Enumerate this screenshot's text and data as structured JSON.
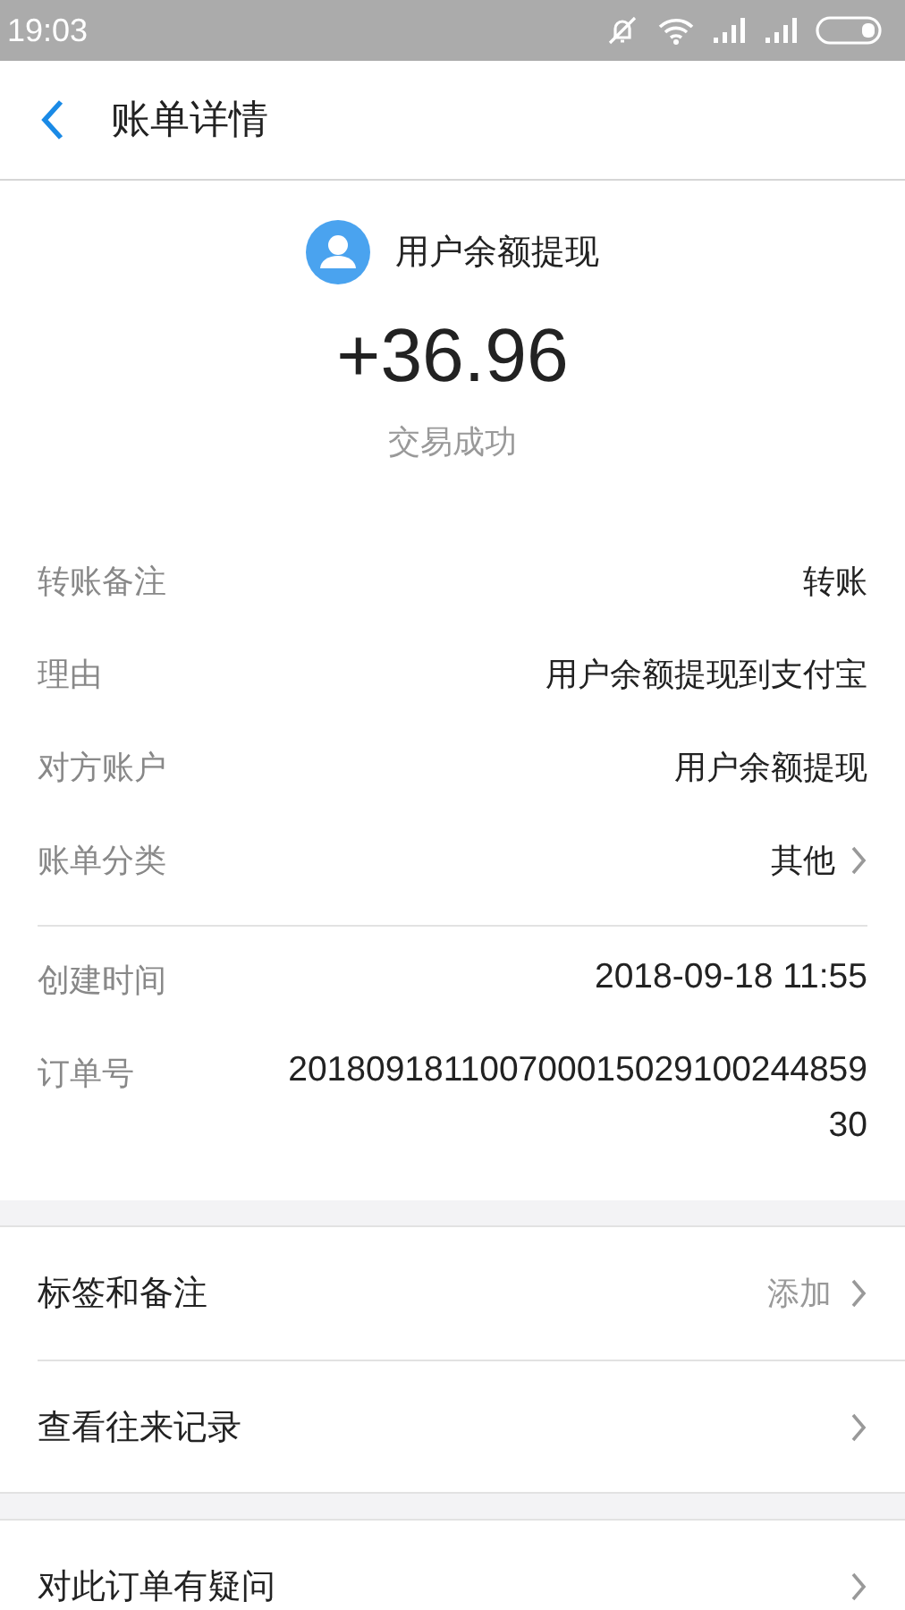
{
  "status_bar": {
    "time": "19:03"
  },
  "header": {
    "title": "账单详情"
  },
  "summary": {
    "name": "用户余额提现",
    "amount": "+36.96",
    "status": "交易成功"
  },
  "details": [
    {
      "label": "转账备注",
      "value": "转账",
      "has_arrow": false
    },
    {
      "label": "理由",
      "value": "用户余额提现到支付宝",
      "has_arrow": false
    },
    {
      "label": "对方账户",
      "value": "用户余额提现",
      "has_arrow": false
    },
    {
      "label": "账单分类",
      "value": "其他",
      "has_arrow": true
    }
  ],
  "order_info": [
    {
      "label": "创建时间",
      "value": "2018-09-18 11:55"
    },
    {
      "label": "订单号",
      "value": "20180918110070001502910024485930"
    }
  ],
  "actions": [
    {
      "label": "标签和备注",
      "hint": "添加"
    },
    {
      "label": "查看往来记录"
    }
  ],
  "footer_action": {
    "label": "对此订单有疑问"
  }
}
